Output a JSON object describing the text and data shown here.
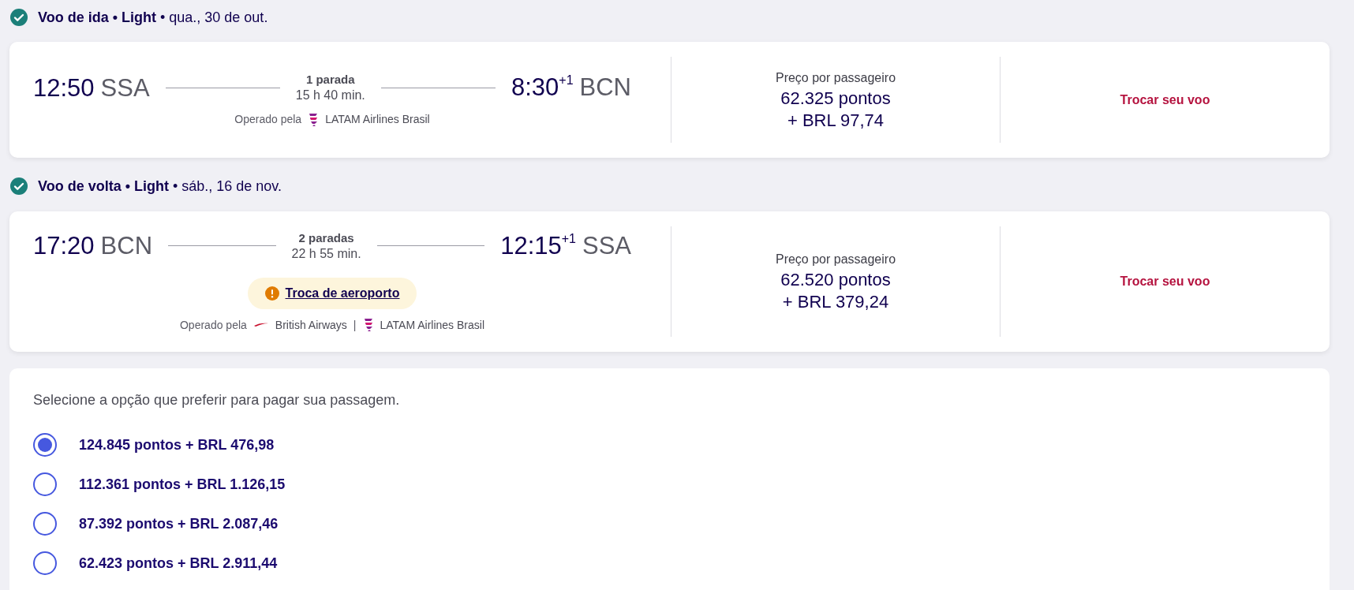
{
  "flights": [
    {
      "header": "**Voo de ida • Light** • qua., 30 de out.",
      "confirmed": true,
      "departure_time": "12:50",
      "departure_airport": "SSA",
      "stops": "1 parada",
      "duration": "15 h 40 min.",
      "arrival_time": "8:30",
      "arrival_day_offset": "+1",
      "arrival_airport": "BCN",
      "operated_label": "Operado pela",
      "operators": [
        {
          "kind": "latam",
          "name": "LATAM Airlines Brasil"
        }
      ],
      "price_label": "Preço por passageiro",
      "price_points": "62.325 pontos",
      "price_cash": "+ BRL 97,74",
      "change_link": "Trocar seu voo"
    },
    {
      "header": "**Voo de volta • Light** • sáb., 16 de nov.",
      "confirmed": true,
      "departure_time": "17:20",
      "departure_airport": "BCN",
      "stops": "2 paradas",
      "duration": "22 h 55 min.",
      "arrival_time": "12:15",
      "arrival_day_offset": "+1",
      "arrival_airport": "SSA",
      "alert": "Troca de aeroporto",
      "operated_label": "Operado pela",
      "separator": "|",
      "operators": [
        {
          "kind": "ba",
          "name": "British Airways"
        },
        {
          "kind": "latam",
          "name": "LATAM Airlines Brasil"
        }
      ],
      "price_label": "Preço por passageiro",
      "price_points": "62.520 pontos",
      "price_cash": "+ BRL 379,24",
      "change_link": "Trocar seu voo"
    }
  ],
  "payment": {
    "prompt": "Selecione a opção que preferir para pagar sua passagem.",
    "options": [
      {
        "label": "124.845 pontos + BRL 476,98",
        "selected": true
      },
      {
        "label": "112.361 pontos + BRL 1.126,15",
        "selected": false
      },
      {
        "label": "87.392 pontos + BRL 2.087,46",
        "selected": false
      },
      {
        "label": "62.423 pontos + BRL 2.911,44",
        "selected": false
      }
    ]
  }
}
